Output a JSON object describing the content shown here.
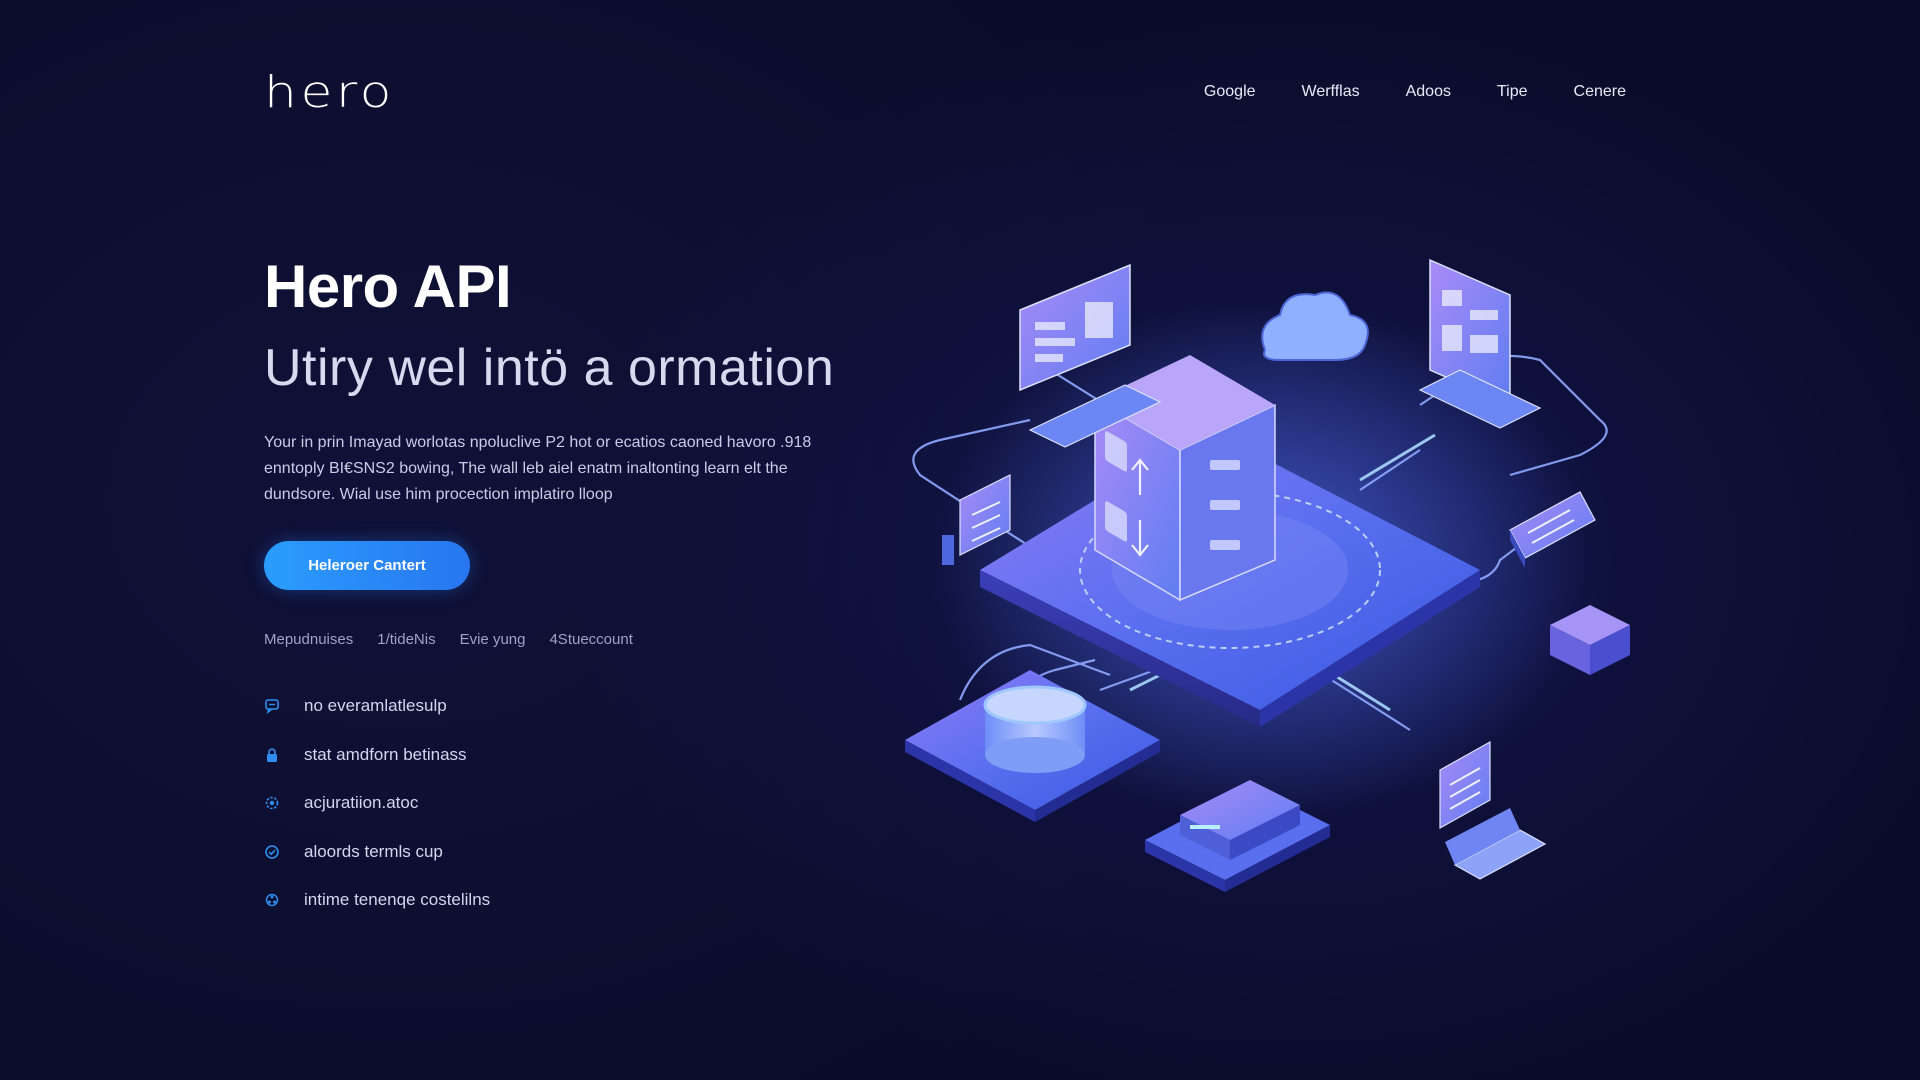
{
  "header": {
    "logo": "hero",
    "nav": [
      "Google",
      "Werfflas",
      "Adoos",
      "Tipe",
      "Cenere"
    ]
  },
  "hero": {
    "title": "Hero API",
    "subtitle": "Utiry wel intö a ormation",
    "description_lines": [
      "Your in prin Imayad worlotas npoluclive P2 hot or ecatios caoned havoro .918",
      "enntoply BI€SNS2 bowing, The wall leb aiel enatm inaltonting learn elt the",
      "dundsore. Wial use him procection implatiro lloop"
    ],
    "cta_label": "Heleroer Cantert"
  },
  "meta": [
    "Mepudnuises",
    "1/tideNis",
    "Evie yung",
    "4Stueccount"
  ],
  "features": [
    {
      "icon": "chat-icon",
      "label": "no everamlatlesulp"
    },
    {
      "icon": "lock-icon",
      "label": "stat amdforn betinass"
    },
    {
      "icon": "gear-icon",
      "label": "acjuratiion.atoc"
    },
    {
      "icon": "check-circle-icon",
      "label": "aloords termls cup"
    },
    {
      "icon": "network-icon",
      "label": "intime tenenqe costelilns"
    }
  ],
  "colors": {
    "background": "#0b0c2a",
    "accent": "#2a9dff",
    "icon": "#2e8ef0",
    "illustration_purple": "#8a6cf0",
    "illustration_blue": "#4a7cf2"
  }
}
